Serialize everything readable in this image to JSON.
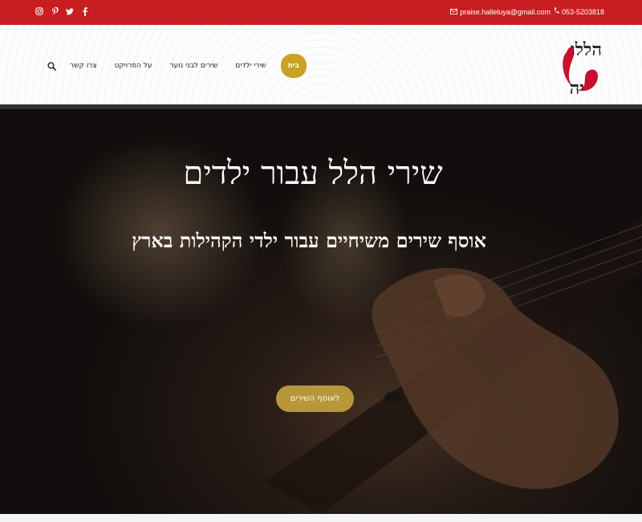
{
  "topbar": {
    "phone": "053-5203818",
    "email": "praise.halleluya@gmail.com",
    "social_icons": [
      "instagram-icon",
      "pinterest-icon",
      "twitter-icon",
      "facebook-icon"
    ],
    "background": "#c81e22"
  },
  "logo": {
    "line1": "הללו",
    "line2": "יה"
  },
  "nav": {
    "items": [
      {
        "label": "צרו קשר"
      },
      {
        "label": "על הפרויקט"
      },
      {
        "label": "שירים לבני נוער"
      },
      {
        "label": "שירי ילדים"
      }
    ],
    "home_label": "בית",
    "accent": "#c9a227"
  },
  "hero": {
    "title": "שירי הלל עבור ילדים",
    "subtitle": "אוסף שירים משיחיים עבור ילדי הקהילות בארץ",
    "cta_label": "לאוסף השירים",
    "cta_color": "#b8973a"
  }
}
